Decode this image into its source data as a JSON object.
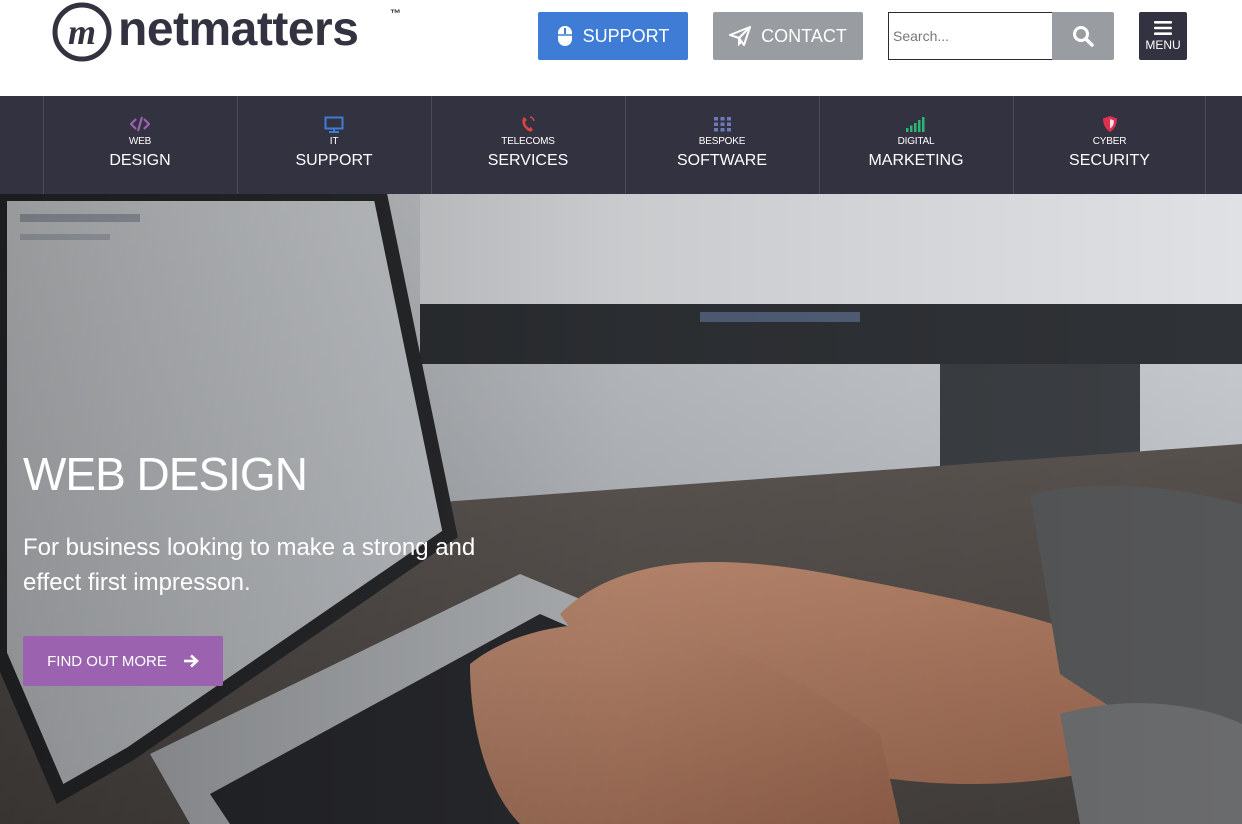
{
  "header": {
    "logo": {
      "text": "netmatters",
      "trademark": "™"
    },
    "support_label": "SUPPORT",
    "contact_label": "CONTACT",
    "search": {
      "placeholder": "Search..."
    },
    "menu_label": "MENU"
  },
  "nav": {
    "items": [
      {
        "small": "WEB",
        "big": "DESIGN",
        "icon": "code-icon",
        "color": "#9b62b0"
      },
      {
        "small": "IT",
        "big": "SUPPORT",
        "icon": "monitor-icon",
        "color": "#3e7cd6"
      },
      {
        "small": "TELECOMS",
        "big": "SERVICES",
        "icon": "phone-icon",
        "color": "#d64541"
      },
      {
        "small": "BESPOKE",
        "big": "SOFTWARE",
        "icon": "grid-icon",
        "color": "#6c7ab8"
      },
      {
        "small": "DIGITAL",
        "big": "MARKETING",
        "icon": "signal-bars-icon",
        "color": "#2bb673"
      },
      {
        "small": "CYBER",
        "big": "SECURITY",
        "icon": "shield-icon",
        "color": "#e0304f"
      }
    ]
  },
  "hero": {
    "title": "WEB DESIGN",
    "subtitle": "For business looking to make a strong and effect first impresson.",
    "cta_label": "FIND OUT MORE",
    "cta_color": "#9b62b0"
  },
  "colors": {
    "brand_dark": "#333241",
    "support_blue": "#3e7cd6",
    "contact_grey": "#999ca1"
  }
}
